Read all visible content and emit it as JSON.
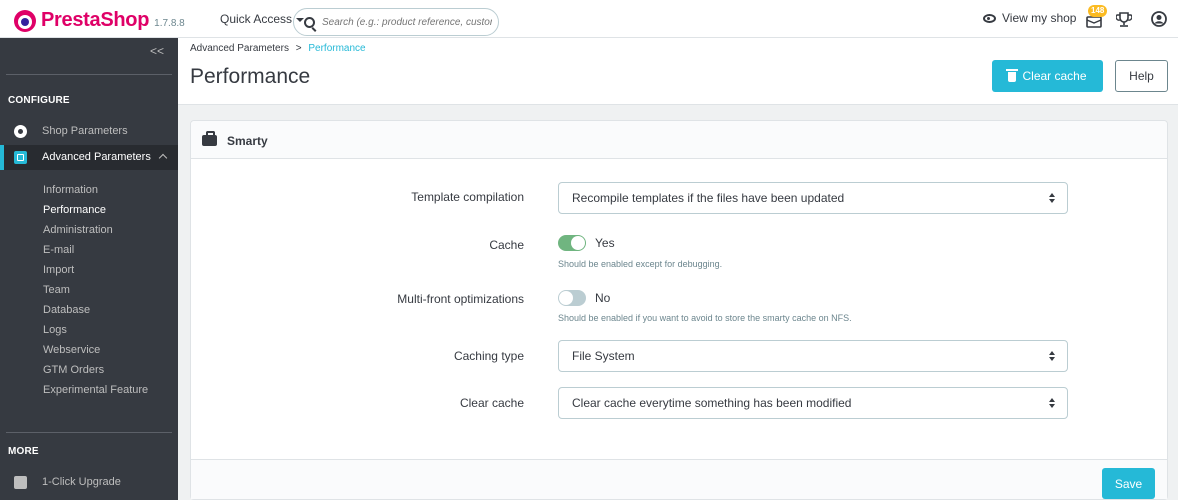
{
  "header": {
    "logo_text": "PrestaShop",
    "version": "1.7.8.8",
    "quick_access": "Quick Access",
    "search_placeholder": "Search (e.g.: product reference, custon",
    "view_shop": "View my shop",
    "notifications_count": "148"
  },
  "sidebar": {
    "collapse": "<<",
    "configure_label": "CONFIGURE",
    "items": [
      {
        "label": "Shop Parameters",
        "icon": "gear-icon"
      },
      {
        "label": "Advanced Parameters",
        "icon": "advanced-parameters-icon"
      }
    ],
    "submenu": [
      "Information",
      "Performance",
      "Administration",
      "E-mail",
      "Import",
      "Team",
      "Database",
      "Logs",
      "Webservice",
      "GTM Orders",
      "Experimental Feature"
    ],
    "more_label": "MORE",
    "upgrade_label": "1-Click Upgrade"
  },
  "breadcrumb": {
    "parent": "Advanced Parameters",
    "separator": ">",
    "current": "Performance"
  },
  "page": {
    "title": "Performance",
    "clear_cache_button": "Clear cache",
    "help_button": "Help"
  },
  "card": {
    "title": "Smarty",
    "template_compilation": {
      "label": "Template compilation",
      "value": "Recompile templates if the files have been updated"
    },
    "cache": {
      "label": "Cache",
      "state": "Yes",
      "enabled": true,
      "help": "Should be enabled except for debugging."
    },
    "multifront": {
      "label": "Multi-front optimizations",
      "state": "No",
      "enabled": false,
      "help": "Should be enabled if you want to avoid to store the smarty cache on NFS."
    },
    "caching_type": {
      "label": "Caching type",
      "value": "File System"
    },
    "clear_cache": {
      "label": "Clear cache",
      "value": "Clear cache everytime something has been modified"
    },
    "save_button": "Save"
  },
  "colors": {
    "accent": "#25b9d7",
    "switch_on": "#70b580",
    "sidebar_bg": "#363a41",
    "brand": "#df0067"
  }
}
